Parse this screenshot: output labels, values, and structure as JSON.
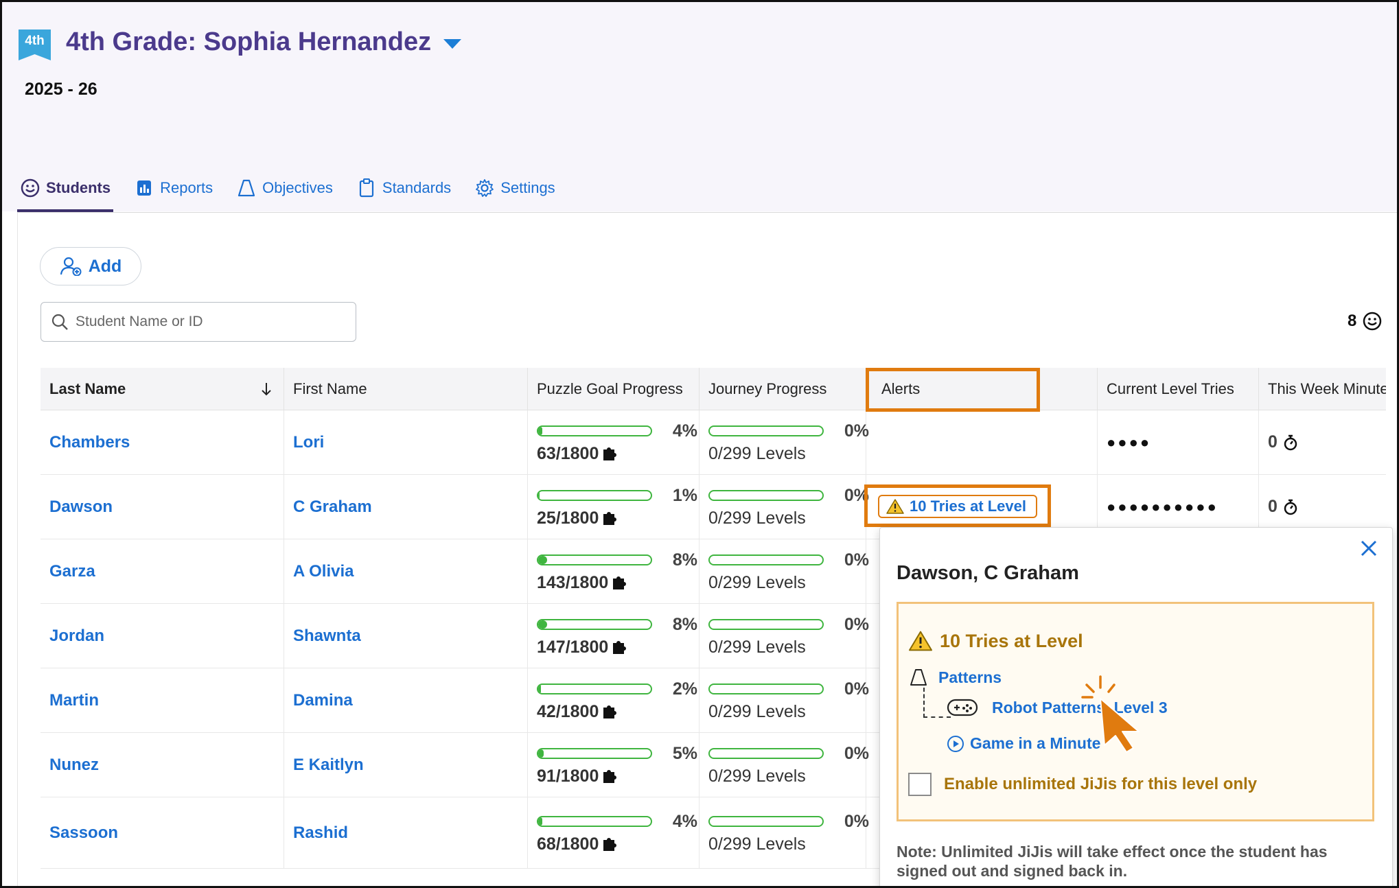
{
  "header": {
    "grade_badge": "4th",
    "class_title": "4th Grade: Sophia Hernandez",
    "school_year": "2025 - 26"
  },
  "tabs": [
    {
      "label": "Students",
      "icon": "smiley-icon",
      "active": true
    },
    {
      "label": "Reports",
      "icon": "reports-icon",
      "active": false
    },
    {
      "label": "Objectives",
      "icon": "flask-icon",
      "active": false
    },
    {
      "label": "Standards",
      "icon": "clipboard-icon",
      "active": false
    },
    {
      "label": "Settings",
      "icon": "gear-icon",
      "active": false
    }
  ],
  "toolbar": {
    "add_label": "Add",
    "search_placeholder": "Student Name or ID",
    "student_count": "8"
  },
  "table": {
    "columns": [
      "Last Name",
      "First Name",
      "Puzzle Goal Progress",
      "Journey Progress",
      "Alerts",
      "Current Level Tries",
      "This Week Minute"
    ],
    "rows": [
      {
        "last": "Chambers",
        "first": "Lori",
        "puzzle_pct": "4%",
        "puzzle_fraction": 0.035,
        "puzzle_count": "63/1800",
        "journey_pct": "0%",
        "journey_count": "0/299 Levels",
        "alert": "",
        "tries": "●●●●",
        "minutes": "0"
      },
      {
        "last": "Dawson",
        "first": "C Graham",
        "puzzle_pct": "1%",
        "puzzle_fraction": 0.014,
        "puzzle_count": "25/1800",
        "journey_pct": "0%",
        "journey_count": "0/299 Levels",
        "alert": "10 Tries at Level",
        "tries": "●●●●●●●●●●",
        "minutes": "0"
      },
      {
        "last": "Garza",
        "first": "A Olivia",
        "puzzle_pct": "8%",
        "puzzle_fraction": 0.079,
        "puzzle_count": "143/1800",
        "journey_pct": "0%",
        "journey_count": "0/299 Levels",
        "alert": "",
        "tries": "",
        "minutes": ""
      },
      {
        "last": "Jordan",
        "first": "Shawnta",
        "puzzle_pct": "8%",
        "puzzle_fraction": 0.082,
        "puzzle_count": "147/1800",
        "journey_pct": "0%",
        "journey_count": "0/299 Levels",
        "alert": "",
        "tries": "",
        "minutes": ""
      },
      {
        "last": "Martin",
        "first": "Damina",
        "puzzle_pct": "2%",
        "puzzle_fraction": 0.023,
        "puzzle_count": "42/1800",
        "journey_pct": "0%",
        "journey_count": "0/299 Levels",
        "alert": "",
        "tries": "",
        "minutes": ""
      },
      {
        "last": "Nunez",
        "first": "E Kaitlyn",
        "puzzle_pct": "5%",
        "puzzle_fraction": 0.051,
        "puzzle_count": "91/1800",
        "journey_pct": "0%",
        "journey_count": "0/299 Levels",
        "alert": "",
        "tries": "",
        "minutes": ""
      },
      {
        "last": "Sassoon",
        "first": "Rashid",
        "puzzle_pct": "4%",
        "puzzle_fraction": 0.038,
        "puzzle_count": "68/1800",
        "journey_pct": "0%",
        "journey_count": "0/299 Levels",
        "alert": "",
        "tries": "",
        "minutes": ""
      }
    ]
  },
  "popover": {
    "student": "Dawson, C Graham",
    "alert_title": "10 Tries at Level",
    "objective": "Patterns",
    "level": "Robot Patterns, Level 3",
    "video": "Game in a Minute",
    "checkbox_label": "Enable unlimited JiJis for this level only",
    "note": "Note: Unlimited JiJis will take effect once the student has signed out and signed back in."
  },
  "colors": {
    "brand_purple": "#4b3a8c",
    "link_blue": "#1c6fd1",
    "progress_green": "#3fb53f",
    "highlight_orange": "#e07b0f",
    "alert_gold": "#a8750b"
  }
}
